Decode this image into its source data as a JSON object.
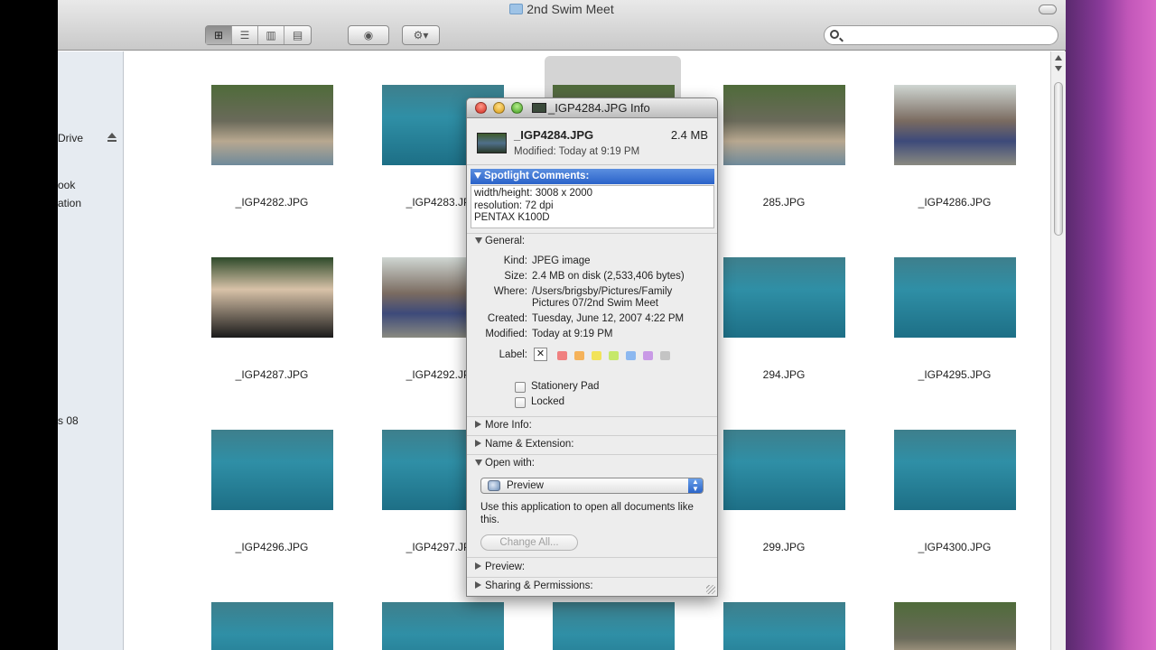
{
  "window": {
    "title": "2nd Swim Meet"
  },
  "sidebar": {
    "items": [
      "Drive",
      "ook",
      "ation",
      "s 08"
    ]
  },
  "toolbar": {
    "view_icons": [
      "icon-view-icon",
      "list-view-icon",
      "column-view-icon",
      "coverflow-view-icon"
    ],
    "quicklook": "eye-icon",
    "action": "gear-icon"
  },
  "files": [
    "_IGP4282.JPG",
    "_IGP4283.JPG",
    "",
    "285.JPG",
    "_IGP4286.JPG",
    "_IGP4287.JPG",
    "_IGP4292.JPG",
    "",
    "294.JPG",
    "_IGP4295.JPG",
    "_IGP4296.JPG",
    "_IGP4297.JPG",
    "",
    "299.JPG",
    "_IGP4300.JPG"
  ],
  "info": {
    "title": "_IGP4284.JPG Info",
    "name": "_IGP4284.JPG",
    "size": "2.4 MB",
    "modified_line": "Modified: Today at 9:19 PM",
    "spotlight_header": "Spotlight Comments:",
    "spotlight_lines": [
      "width/height: 3008 x 2000",
      "resolution: 72 dpi",
      "PENTAX K100D"
    ],
    "general_header": "General:",
    "general": {
      "kind_key": "Kind:",
      "kind": "JPEG image",
      "size_key": "Size:",
      "size": "2.4 MB on disk (2,533,406 bytes)",
      "where_key": "Where:",
      "where": "/Users/brigsby/Pictures/Family Pictures 07/2nd Swim Meet",
      "created_key": "Created:",
      "created": "Tuesday, June 12, 2007 4:22 PM",
      "modified_key": "Modified:",
      "modified": "Today at 9:19 PM",
      "label_key": "Label:",
      "label_none": "✕"
    },
    "label_colors": [
      "#f08080",
      "#f5b25a",
      "#f2e35a",
      "#c6e86a",
      "#8cb8f0",
      "#c99ae6",
      "#c4c4c4"
    ],
    "stationery": "Stationery Pad",
    "locked": "Locked",
    "more_info": "More Info:",
    "name_ext": "Name & Extension:",
    "open_with": "Open with:",
    "open_with_app": "Preview",
    "open_with_desc": "Use this application to open all documents like this.",
    "change_all": "Change All...",
    "preview": "Preview:",
    "sharing": "Sharing & Permissions:"
  }
}
